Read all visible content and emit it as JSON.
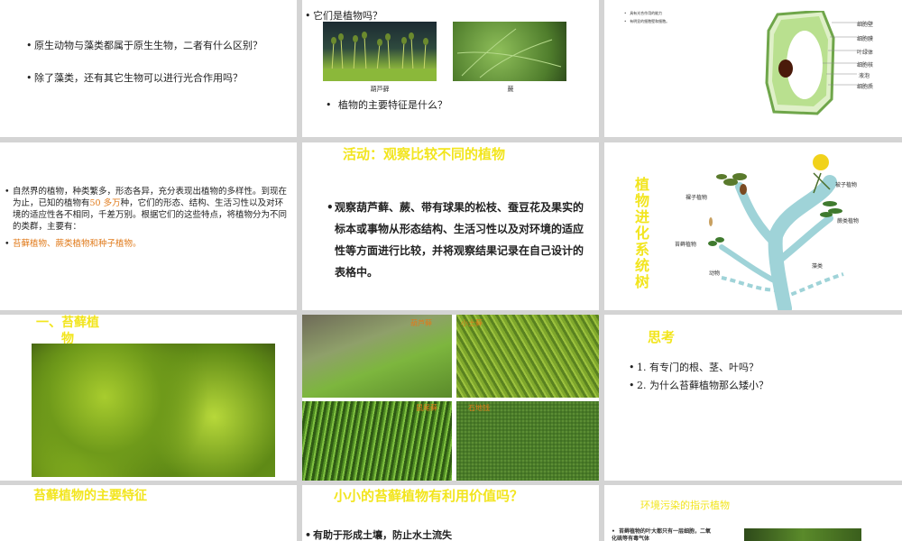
{
  "s1": {
    "q1": "原生动物与藻类都属于原生生物，二者有什么区别？",
    "q2": "除了藻类，还有其它生物可以进行光合作用吗？"
  },
  "s2": {
    "q": "它们是植物吗？",
    "cap1": "葫芦藓",
    "cap2": "蕨",
    "q2": "植物的主要特征是什么？"
  },
  "s3": {
    "note1": "具有光合作用的能力",
    "note2": "有明显的细胞壁和细胞。",
    "labels": [
      "细胞壁",
      "细胞膜",
      "叶绿体",
      "细胞核",
      "液泡",
      "细胞质"
    ]
  },
  "s4": {
    "p1a": "自然界的植物，种类繁多，形态各异，充分表现出植物的多样性。到现在为止，已知的植物有",
    "p1num": "50 多万",
    "p1b": "种，它们的形态、结构、生活习性以及对环境的适应性各不相同，千差万别。根据它们的这些特点，将植物分为不同的类群，主要有：",
    "p2": "苔藓植物、蕨类植物和种子植物。"
  },
  "s5": {
    "title": "活动：观察比较不同的植物",
    "body": "观察葫芦藓、蕨、带有球果的松枝、蚕豆花及果实的标本或事物从形态结构、生活习性以及对环境的适应性等方面进行比较，并将观察结果记录在自己设计的表格中。"
  },
  "s6": {
    "title": "植物进化系统树",
    "labels": [
      "被子植物",
      "裸子植物",
      "蕨类植物",
      "苔藓植物",
      "动物",
      "藻类"
    ]
  },
  "s7": {
    "title": "一、苔藓植物"
  },
  "s8": {
    "labels": [
      "葫芦藓",
      "小土藓",
      "鼠尾藓",
      "石地钱"
    ]
  },
  "s9": {
    "title": "思考",
    "q1": "1. 有专门的根、茎、叶吗？",
    "q2": "2. 为什么苔藓植物那么矮小？"
  },
  "s10": {
    "title": "苔藓植物的主要特征"
  },
  "s11": {
    "title": "小小的苔藓植物有利用价值吗？",
    "b1": "有助于形成土壤，防止水土流失"
  },
  "s12": {
    "title": "环境污染的指示植物",
    "b1": "苔藓植物的叶大都只有一层细胞，二氧化硫等有毒气体"
  },
  "colors": {
    "title_yellow": "#f2e51e",
    "accent_orange": "#e07a1a",
    "moss_green": "#6aa12a"
  }
}
